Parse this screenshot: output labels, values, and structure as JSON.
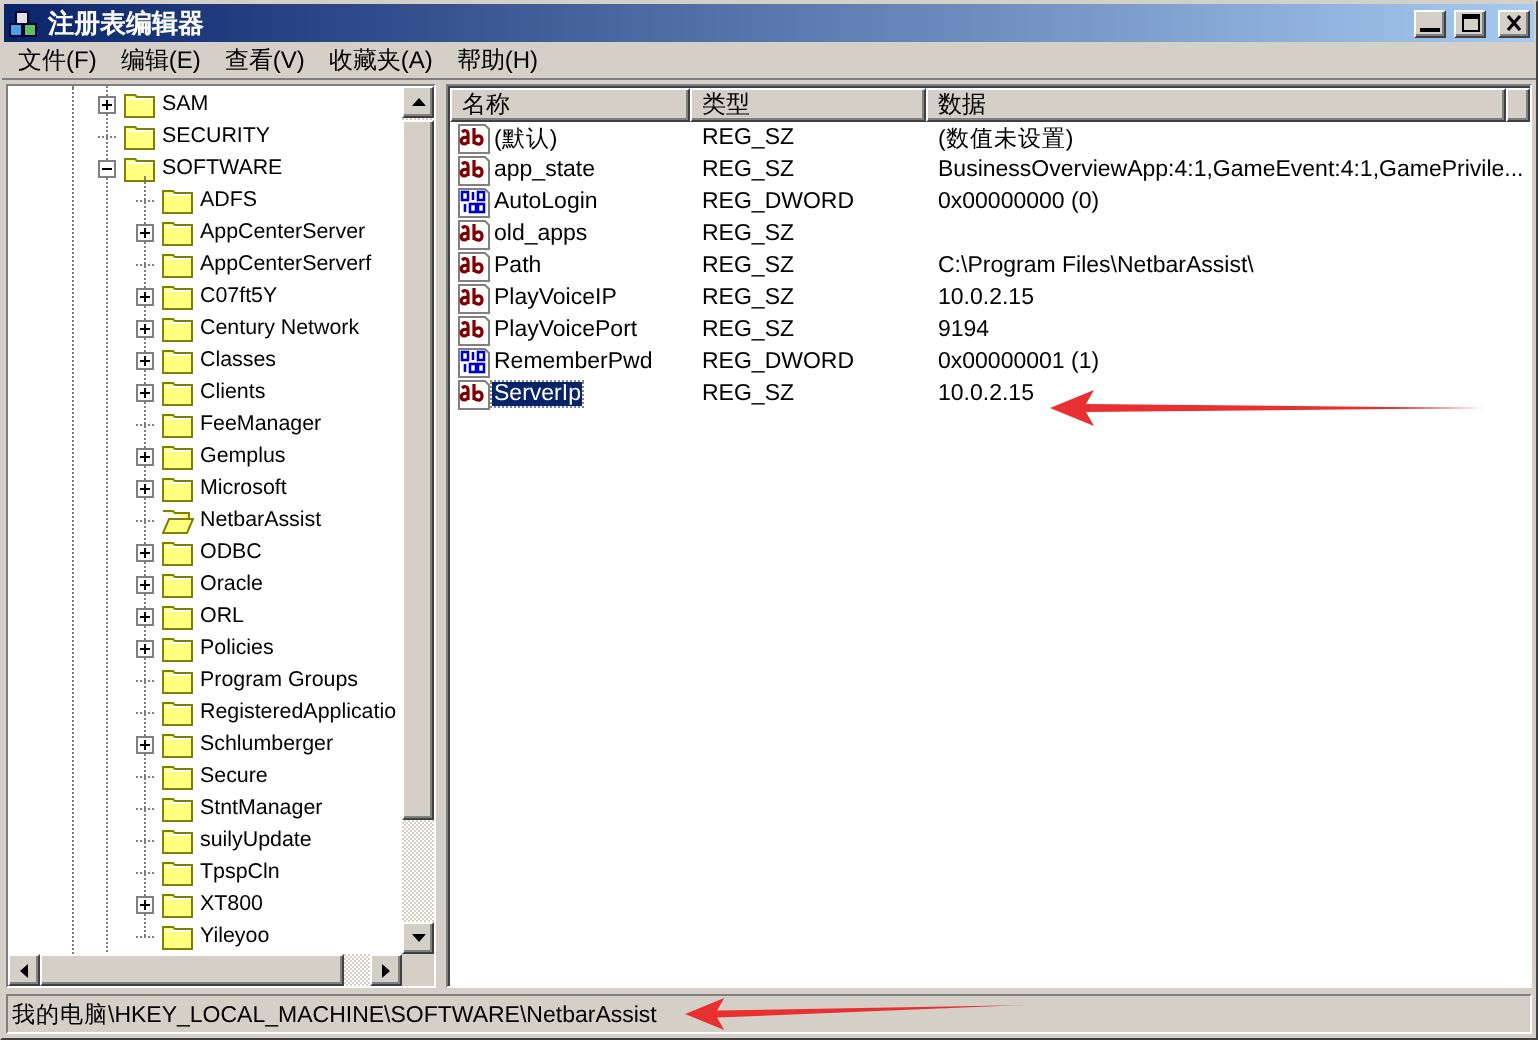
{
  "window": {
    "title": "注册表编辑器"
  },
  "menu": [
    "文件(F)",
    "编辑(E)",
    "查看(V)",
    "收藏夹(A)",
    "帮助(H)"
  ],
  "tree": [
    {
      "label": "SAM",
      "kind": "collapsed",
      "selected": false
    },
    {
      "label": "SECURITY",
      "kind": "leaf",
      "selected": false
    },
    {
      "label": "SOFTWARE",
      "kind": "expanded",
      "selected": false,
      "children": [
        {
          "label": "ADFS",
          "kind": "leaf",
          "selected": false
        },
        {
          "label": "AppCenterServer",
          "kind": "collapsed",
          "selected": false
        },
        {
          "label": "AppCenterServerf",
          "kind": "leaf",
          "selected": false
        },
        {
          "label": "C07ft5Y",
          "kind": "collapsed",
          "selected": false
        },
        {
          "label": "Century Network",
          "kind": "collapsed",
          "selected": false
        },
        {
          "label": "Classes",
          "kind": "collapsed",
          "selected": false
        },
        {
          "label": "Clients",
          "kind": "collapsed",
          "selected": false
        },
        {
          "label": "FeeManager",
          "kind": "leaf",
          "selected": false
        },
        {
          "label": "Gemplus",
          "kind": "collapsed",
          "selected": false
        },
        {
          "label": "Microsoft",
          "kind": "collapsed",
          "selected": false
        },
        {
          "label": "NetbarAssist",
          "kind": "leaf",
          "selected": true
        },
        {
          "label": "ODBC",
          "kind": "collapsed",
          "selected": false
        },
        {
          "label": "Oracle",
          "kind": "collapsed",
          "selected": false
        },
        {
          "label": "ORL",
          "kind": "collapsed",
          "selected": false
        },
        {
          "label": "Policies",
          "kind": "collapsed",
          "selected": false
        },
        {
          "label": "Program Groups",
          "kind": "leaf",
          "selected": false
        },
        {
          "label": "RegisteredApplicatio",
          "kind": "leaf",
          "selected": false
        },
        {
          "label": "Schlumberger",
          "kind": "collapsed",
          "selected": false
        },
        {
          "label": "Secure",
          "kind": "leaf",
          "selected": false
        },
        {
          "label": "StntManager",
          "kind": "leaf",
          "selected": false
        },
        {
          "label": "suilyUpdate",
          "kind": "leaf",
          "selected": false
        },
        {
          "label": "TpspCln",
          "kind": "leaf",
          "selected": false
        },
        {
          "label": "XT800",
          "kind": "collapsed",
          "selected": false
        },
        {
          "label": "Yileyoo",
          "kind": "leaf",
          "selected": false
        }
      ]
    }
  ],
  "table": {
    "columns": [
      "名称",
      "类型",
      "数据"
    ],
    "rows": [
      {
        "name": "(默认)",
        "type": "REG_SZ",
        "data": "(数值未设置)",
        "kind": "string",
        "selected": false
      },
      {
        "name": "app_state",
        "type": "REG_SZ",
        "data": "BusinessOverviewApp:4:1,GameEvent:4:1,GamePrivile...",
        "kind": "string",
        "selected": false
      },
      {
        "name": "AutoLogin",
        "type": "REG_DWORD",
        "data": "0x00000000 (0)",
        "kind": "dword",
        "selected": false
      },
      {
        "name": "old_apps",
        "type": "REG_SZ",
        "data": "",
        "kind": "string",
        "selected": false
      },
      {
        "name": "Path",
        "type": "REG_SZ",
        "data": "C:\\Program Files\\NetbarAssist\\",
        "kind": "string",
        "selected": false
      },
      {
        "name": "PlayVoiceIP",
        "type": "REG_SZ",
        "data": "10.0.2.15",
        "kind": "string",
        "selected": false
      },
      {
        "name": "PlayVoicePort",
        "type": "REG_SZ",
        "data": "9194",
        "kind": "string",
        "selected": false
      },
      {
        "name": "RememberPwd",
        "type": "REG_DWORD",
        "data": "0x00000001 (1)",
        "kind": "dword",
        "selected": false
      },
      {
        "name": "ServerIp",
        "type": "REG_SZ",
        "data": "10.0.2.15",
        "kind": "string",
        "selected": true
      }
    ]
  },
  "status_bar": "我的电脑\\HKEY_LOCAL_MACHINE\\SOFTWARE\\NetbarAssist"
}
